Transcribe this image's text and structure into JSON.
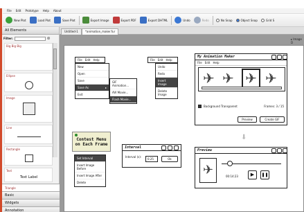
{
  "menubar": {
    "items": [
      "File",
      "Edit",
      "Prototype",
      "Help",
      "About"
    ]
  },
  "toolbar": {
    "buttons": [
      {
        "label": "New Plot",
        "color": "#3aa13a"
      },
      {
        "label": "Load Plot",
        "color": "#3a6fc4"
      },
      {
        "label": "Save Plot",
        "color": "#3a6fc4"
      },
      {
        "label": "Export Image",
        "color": "#4b8c3b"
      },
      {
        "label": "Export PDF",
        "color": "#c03a3a"
      },
      {
        "label": "Export DHTML",
        "color": "#3a6fc4"
      },
      {
        "label": "Undo",
        "color": "#3a77d4"
      },
      {
        "label": "Redo",
        "color": "#9aa9c0"
      }
    ],
    "snap": [
      "No Snap",
      "Object Snap",
      "Grid S"
    ]
  },
  "sidebar": {
    "header": "All Elements",
    "filter_label": "Filter:",
    "items": [
      {
        "label": "Big Big Big"
      },
      {
        "label": "Ellipse"
      },
      {
        "label": "Image"
      },
      {
        "label": "Line"
      },
      {
        "label": "Rectangle"
      },
      {
        "label": "Text",
        "preview": "Text Label"
      },
      {
        "label": "Triangle"
      }
    ],
    "categories": [
      "Basic",
      "Widgets",
      "Annotation"
    ]
  },
  "tabs": {
    "tab1": "Untitled-1",
    "tab2": "*animation_maker.fur",
    "canvas_label": "Image D"
  },
  "file_menu": {
    "bar": [
      "File",
      "Edit",
      "Help"
    ],
    "items": [
      "New",
      "Open",
      "Save",
      "Save As",
      "Exit"
    ],
    "submenu": [
      "GIF Animation...",
      "AVI Movie...",
      "Flash Movie..."
    ]
  },
  "edit_menu": {
    "bar": [
      "File",
      "Edit",
      "Help"
    ],
    "items": [
      "Undo",
      "Redo",
      "Insert Image",
      "Delete Image"
    ]
  },
  "main_window": {
    "title": "My Animation Maker",
    "menu": [
      "File",
      "Edit",
      "Help"
    ],
    "checkbox_label": "Background Transparent",
    "frames": "Frames: 3 / 15",
    "preview_button": "Preview",
    "create_button": "Create GIF"
  },
  "sticky": {
    "text": "Contest Menu on Each Frame"
  },
  "context_menu": {
    "items": [
      "Set Interval",
      "Insert Image Before",
      "Insert Image After",
      "Delete"
    ]
  },
  "interval": {
    "title": "Interval",
    "label": "Interval (s):",
    "value": "0.25",
    "ok": "Ok"
  },
  "preview": {
    "title": "Preview",
    "time": "00:14:23"
  }
}
